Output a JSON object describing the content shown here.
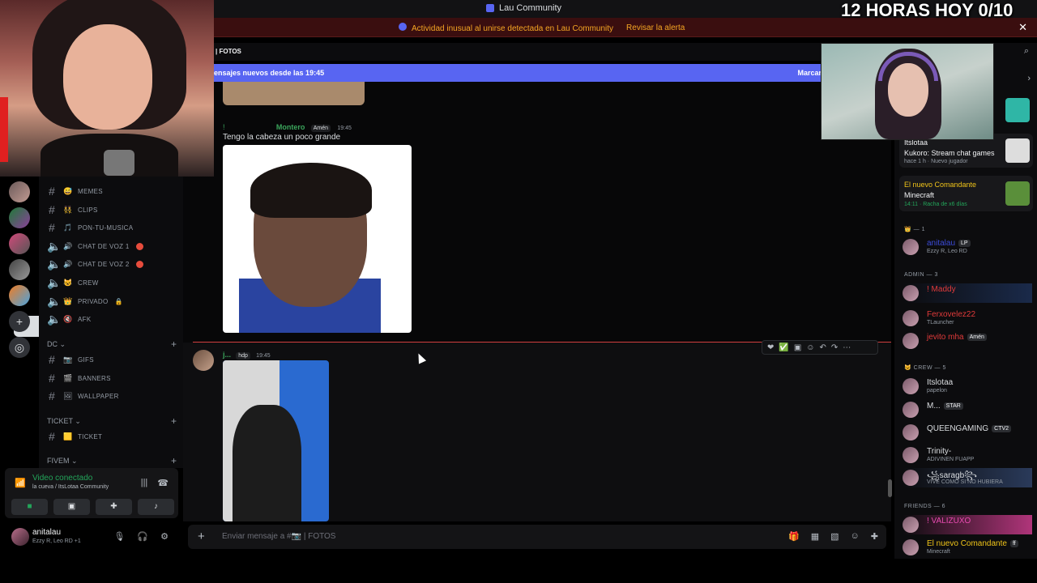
{
  "app": {
    "title": "Lau Community",
    "stream_goal": "12 HORAS HOY 0/10"
  },
  "alert": {
    "message": "Actividad inusual al unirse detectada en Lau Community",
    "action": "Revisar la alerta"
  },
  "channel": {
    "name": "FOTOS",
    "new_messages": "ensajes nuevos desde las 19:45",
    "mark_read": "Marcar"
  },
  "channels": {
    "items": [
      {
        "name": "MEMES",
        "emoji": "😅"
      },
      {
        "name": "CLIPS",
        "emoji": "👯"
      },
      {
        "name": "PON-TU-MUSICA",
        "emoji": "🎵"
      },
      {
        "name": "CHAT DE VOZ 1",
        "emoji": "🔊"
      },
      {
        "name": "CHAT DE VOZ 2",
        "emoji": "🔊"
      },
      {
        "name": "CREW",
        "emoji": "😺"
      },
      {
        "name": "PRIVADO",
        "emoji": "👑"
      },
      {
        "name": "AFK",
        "emoji": "🔇"
      }
    ],
    "cat_dc": "DC ⌄",
    "dc_items": [
      {
        "name": "GIFS",
        "emoji": "📷"
      },
      {
        "name": "BANNERS",
        "emoji": "🎬"
      },
      {
        "name": "WALLPAPER",
        "emoji": "🖼"
      }
    ],
    "cat_ticket": "TICKET ⌄",
    "ticket_items": [
      {
        "name": "TICKET",
        "emoji": "🟨"
      }
    ],
    "cat_fivem": "FIVEM ⌄"
  },
  "voice": {
    "status": "Video conectado",
    "location": "la cueva / ItsLotaa Community"
  },
  "user": {
    "name": "anitalau",
    "status": "Ezzy R, Leo RD +1"
  },
  "messages": [
    {
      "author": "Montero",
      "role": "Amén",
      "time": "19:45",
      "text": "Tengo la cabeza un poco grande",
      "prefix": "!"
    },
    {
      "author": "j...",
      "role": "hdp",
      "time": "19:45"
    }
  ],
  "composer": {
    "placeholder": "Enviar mensaje a #📷 | FOTOS"
  },
  "activities": [
    {
      "user": "Itslotaa",
      "title": "Kukoro: Stream chat games",
      "sub": "hace 1 h · Nuevo jugador"
    },
    {
      "user": "El nuevo Comandante",
      "title": "Minecraft",
      "sub": "14:11 · Racha de x6 días"
    }
  ],
  "members": {
    "group_top": "— 1",
    "top": [
      {
        "name": "anitalau",
        "badge": "LP",
        "status": "Ezzy R, Leo RD",
        "color": "#3b4bd8"
      }
    ],
    "admin_header": "ADMIN — 3",
    "admin": [
      {
        "name": "! Maddy",
        "status": "",
        "color": "#e03a3a"
      },
      {
        "name": "Ferxovelez22",
        "status": "TLauncher",
        "color": "#e03a3a"
      },
      {
        "name": "jevito mha",
        "badge": "Amén",
        "status": "",
        "color": "#e03a3a"
      }
    ],
    "crew_header": "CREW — 5",
    "crew": [
      {
        "name": "Itslotaa",
        "status": "papelon",
        "color": "#f2f3f5"
      },
      {
        "name": "M...",
        "badge": "STAR",
        "status": "",
        "color": "#f2f3f5"
      },
      {
        "name": "QUEENGAMING",
        "badge": "CTV2",
        "status": "",
        "color": "#f2f3f5"
      },
      {
        "name": "Trinity-",
        "status": "ADIVINEN FUAPP",
        "color": "#f2f3f5"
      },
      {
        "name": "꧁saragb꧂",
        "status": "VIVE COMO SI NO HUBIERA",
        "color": "#f2f3f5"
      }
    ],
    "friends_header": "FRIENDS — 6",
    "friends": [
      {
        "name": "! VALIZUXO",
        "status": "",
        "color": "#e84ab0"
      },
      {
        "name": "El nuevo Comandante",
        "badge": "ff",
        "status": "Minecraft",
        "color": "#f0c419"
      }
    ]
  }
}
